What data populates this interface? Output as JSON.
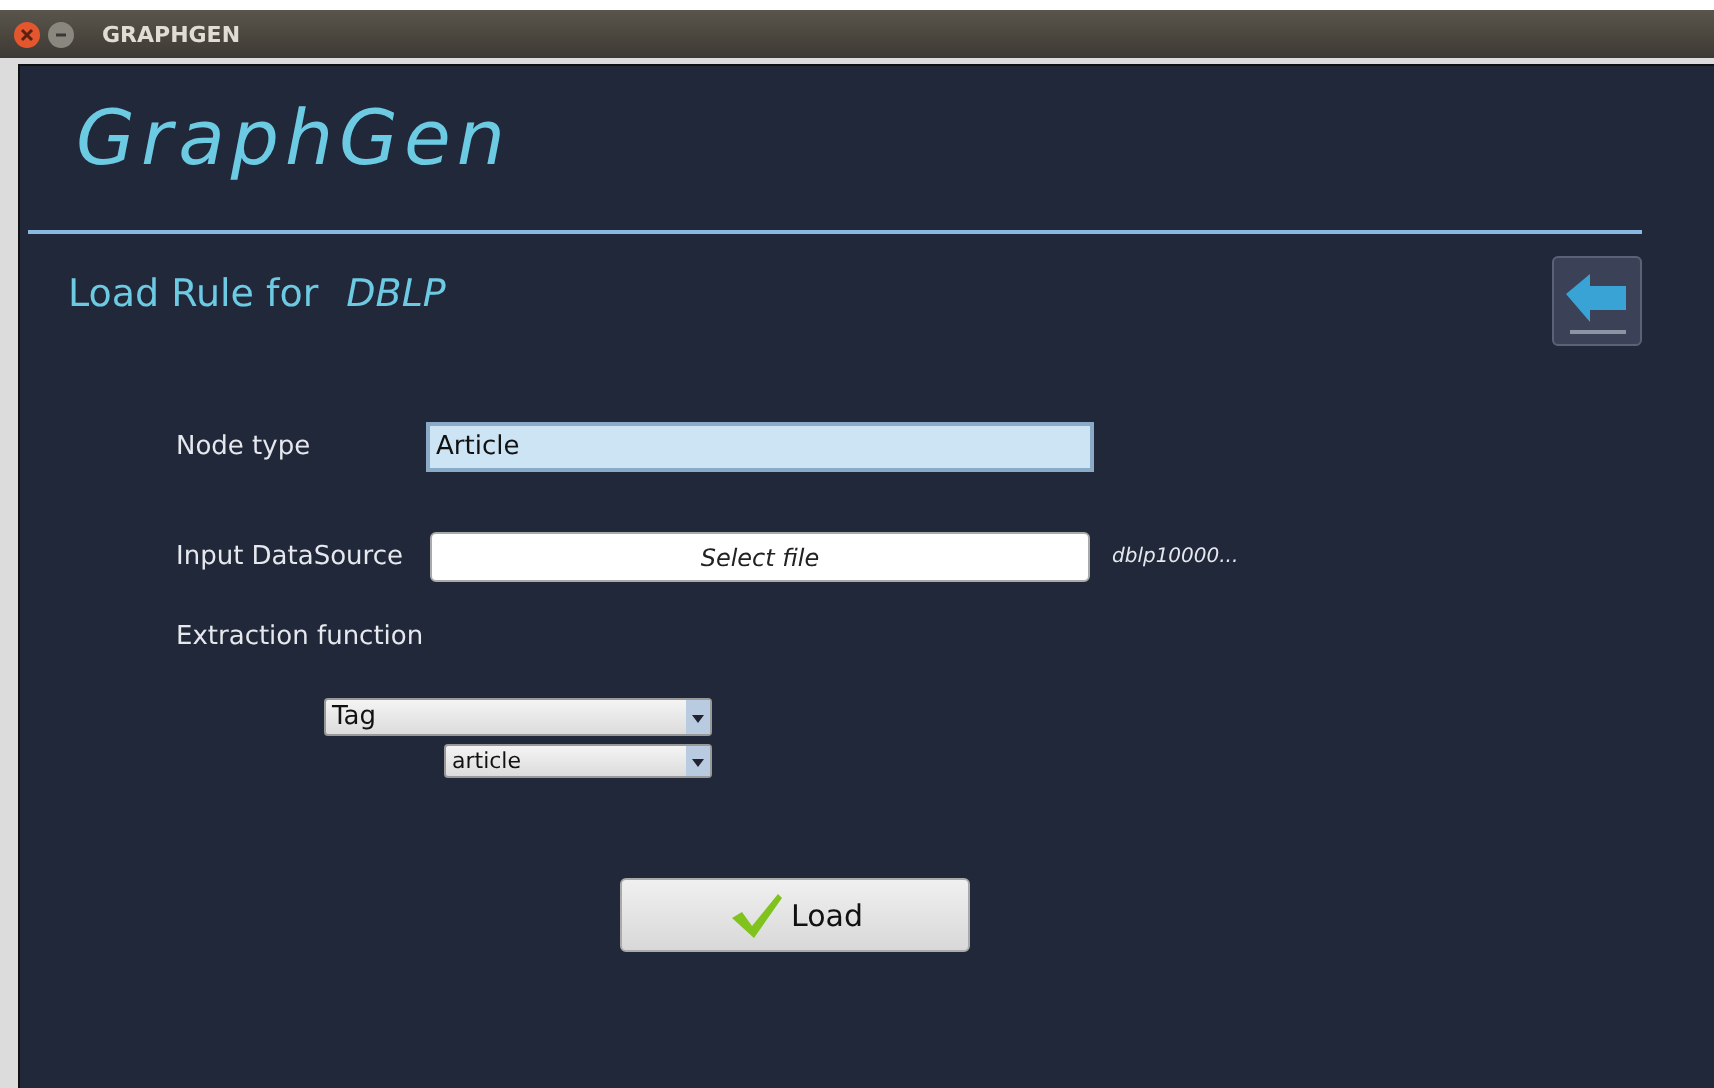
{
  "window": {
    "title": "GRAPHGEN"
  },
  "app_title": "GraphGen",
  "heading": {
    "label": "Load Rule for",
    "dataset": "DBLP"
  },
  "form": {
    "node_type": {
      "label": "Node type",
      "value": "Article"
    },
    "input_datasource": {
      "label": "Input DataSource",
      "button": "Select file",
      "file": "dblp10000..."
    },
    "extraction": {
      "label": "Extraction function",
      "function": "Tag",
      "tag": "article"
    }
  },
  "load_button": "Load"
}
